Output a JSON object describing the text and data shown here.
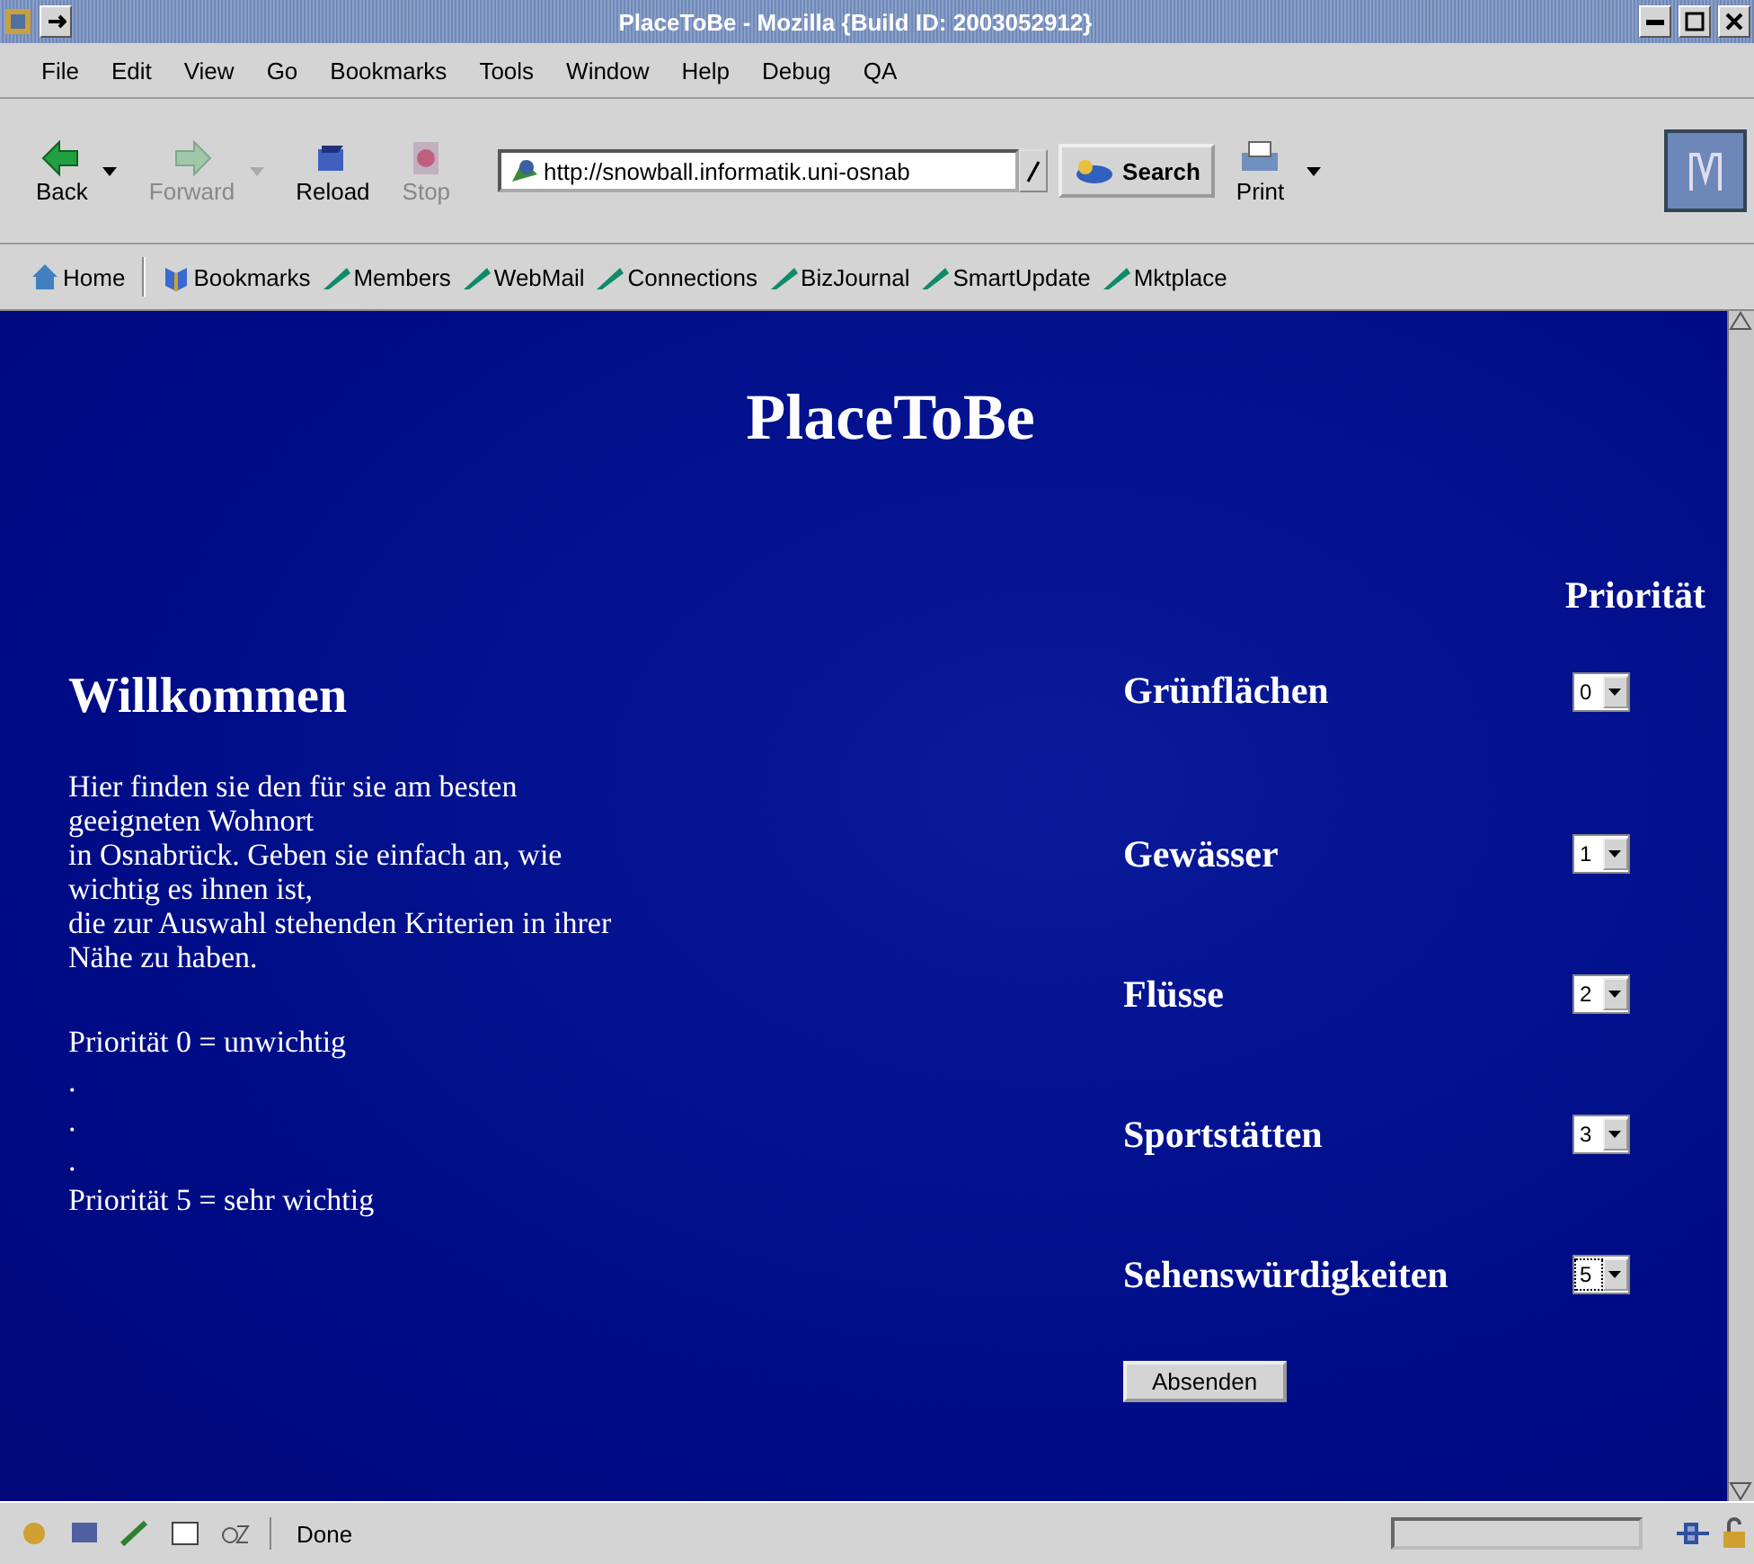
{
  "window": {
    "title": "PlaceToBe - Mozilla {Build ID: 2003052912}"
  },
  "menu": [
    "File",
    "Edit",
    "View",
    "Go",
    "Bookmarks",
    "Tools",
    "Window",
    "Help",
    "Debug",
    "QA"
  ],
  "nav_buttons": [
    {
      "label": "Back",
      "disabled": false,
      "kind": "back",
      "dropdown": true
    },
    {
      "label": "Forward",
      "disabled": true,
      "kind": "forward",
      "dropdown": true
    },
    {
      "label": "Reload",
      "disabled": false,
      "kind": "reload",
      "dropdown": false
    },
    {
      "label": "Stop",
      "disabled": true,
      "kind": "stop",
      "dropdown": false
    }
  ],
  "address": {
    "value": "http://snowball.informatik.uni-osnab"
  },
  "search_button": "Search",
  "print_button": "Print",
  "personal_bar": [
    {
      "label": "Home",
      "kind": "home"
    },
    {
      "label": "Bookmarks",
      "kind": "bookmarks"
    },
    {
      "label": "Members",
      "kind": "link"
    },
    {
      "label": "WebMail",
      "kind": "link"
    },
    {
      "label": "Connections",
      "kind": "link"
    },
    {
      "label": "BizJournal",
      "kind": "link"
    },
    {
      "label": "SmartUpdate",
      "kind": "link"
    },
    {
      "label": "Mktplace",
      "kind": "link"
    }
  ],
  "page": {
    "title": "PlaceToBe",
    "heading": "Willkommen",
    "intro_lines": [
      "Hier finden sie den für sie am besten",
      "geeigneten Wohnort",
      "in Osnabrück. Geben sie einfach an, wie",
      "wichtig es ihnen ist,",
      "die zur Auswahl stehenden Kriterien in ihrer",
      "Nähe zu haben."
    ],
    "legend_lines": [
      "Priorität 0 = unwichtig",
      ".",
      ".",
      ".",
      "Priorität 5 = sehr wichtig"
    ],
    "priority_header": "Priorität",
    "criteria": [
      {
        "label": "Grünflächen",
        "value": "0",
        "focused": false
      },
      {
        "label": "Gewässer",
        "value": "1",
        "focused": false
      },
      {
        "label": "Flüsse",
        "value": "2",
        "focused": false
      },
      {
        "label": "Sportstätten",
        "value": "3",
        "focused": false
      },
      {
        "label": "Sehenswürdigkeiten",
        "value": "5",
        "focused": true
      }
    ],
    "submit": "Absenden"
  },
  "status_bar": {
    "text": "Done",
    "level": 0
  }
}
